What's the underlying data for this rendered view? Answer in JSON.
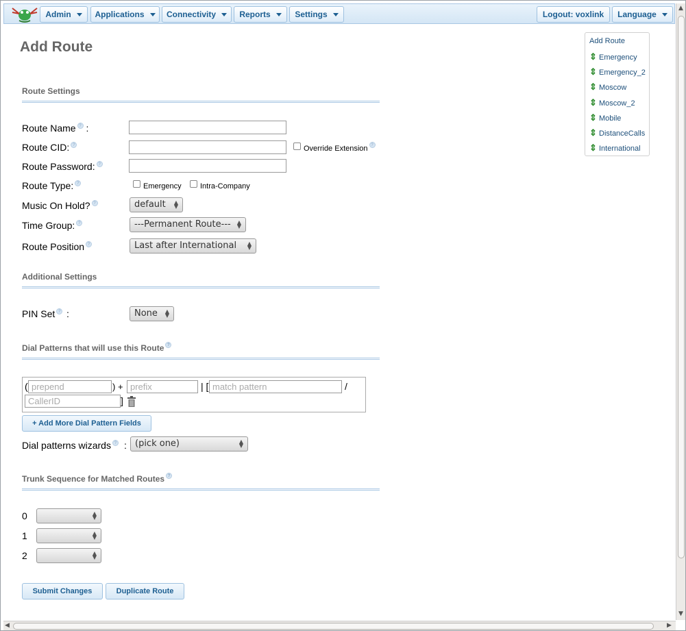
{
  "nav": {
    "admin": "Admin",
    "applications": "Applications",
    "connectivity": "Connectivity",
    "reports": "Reports",
    "settings": "Settings",
    "logout": "Logout: voxlink",
    "language": "Language"
  },
  "page": {
    "title": "Add Route"
  },
  "route_settings": {
    "heading": "Route Settings",
    "route_name_label": "Route Name",
    "route_name_colon": ":",
    "route_cid_label": "Route CID:",
    "override_extension_label": "Override Extension",
    "route_password_label": "Route Password:",
    "route_type_label": "Route Type:",
    "emergency_label": "Emergency",
    "intra_company_label": "Intra-Company",
    "music_on_hold_label": "Music On Hold?",
    "music_on_hold_value": "default",
    "time_group_label": "Time Group:",
    "time_group_value": "---Permanent Route---",
    "route_position_label": "Route Position",
    "route_position_value": "Last after International"
  },
  "additional_settings": {
    "heading": "Additional Settings",
    "pin_set_label": "PIN Set",
    "pin_set_colon": ":",
    "pin_set_value": "None"
  },
  "dial_patterns": {
    "heading": "Dial Patterns that will use this Route",
    "open_paren": "(",
    "close_paren_plus": ") +",
    "pipe_bracket": "| [",
    "slash": "/",
    "close_bracket": "]",
    "prepend_placeholder": "prepend",
    "prefix_placeholder": "prefix",
    "match_pattern_placeholder": "match pattern",
    "callerid_placeholder": "CallerID",
    "add_more_button": "+ Add More Dial Pattern Fields",
    "wizards_label": "Dial patterns wizards",
    "wizards_colon": ":",
    "wizards_value": "(pick one)"
  },
  "trunk_sequence": {
    "heading": "Trunk Sequence for Matched Routes",
    "rows": [
      {
        "index": "0",
        "value": ""
      },
      {
        "index": "1",
        "value": ""
      },
      {
        "index": "2",
        "value": ""
      }
    ]
  },
  "actions": {
    "submit": "Submit Changes",
    "duplicate": "Duplicate Route"
  },
  "route_list": {
    "add_route": "Add Route",
    "items": [
      "Emergency",
      "Emergency_2",
      "Moscow",
      "Moscow_2",
      "Mobile",
      "DistanceCalls",
      "International"
    ]
  },
  "colors": {
    "nav_text": "#1d5f92",
    "section_text": "#666666",
    "route_arrow": "#2e8b2e"
  }
}
